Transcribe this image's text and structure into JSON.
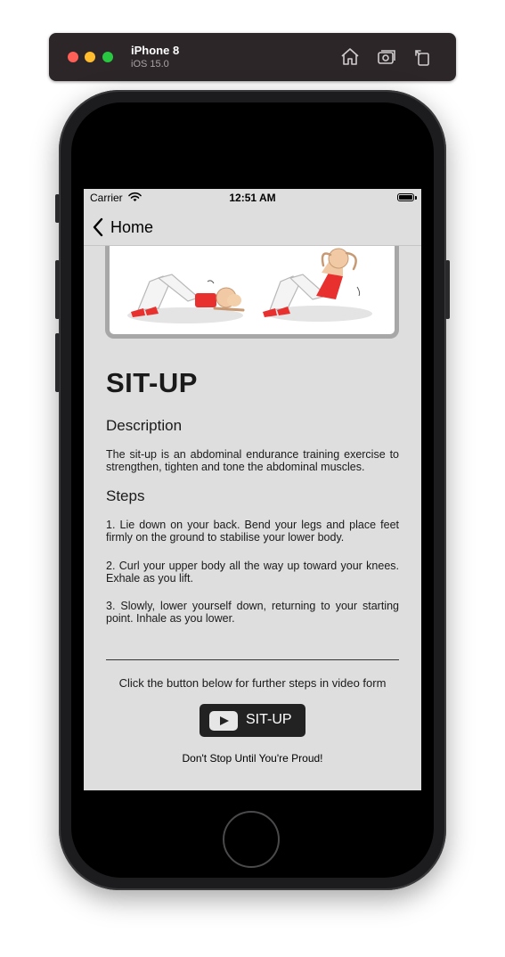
{
  "simulator": {
    "device_name": "iPhone 8",
    "os_version": "iOS 15.0",
    "icons": [
      "home-icon",
      "screenshot-icon",
      "rotate-icon"
    ]
  },
  "status_bar": {
    "carrier": "Carrier",
    "time": "12:51 AM"
  },
  "nav": {
    "back_label": "Home"
  },
  "exercise": {
    "title": "SIT-UP",
    "description_heading": "Description",
    "description": "The sit-up is an abdominal endurance training exercise to strengthen, tighten and tone the abdominal muscles.",
    "steps_heading": "Steps",
    "steps": [
      "1. Lie down on your back. Bend your legs and place feet firmly on the ground to stabilise your lower body.",
      "2. Curl your upper body all the way up toward your knees. Exhale as you lift.",
      "3. Slowly, lower yourself down, returning to your starting point. Inhale as you lower."
    ]
  },
  "video": {
    "hint": "Click the button below for further steps in video form",
    "button_label": "SIT-UP"
  },
  "motto": "Don't Stop Until You're Proud!",
  "colors": {
    "screen_background": "#dedede",
    "button_background": "#222222",
    "accent_red": "#e8302f"
  }
}
